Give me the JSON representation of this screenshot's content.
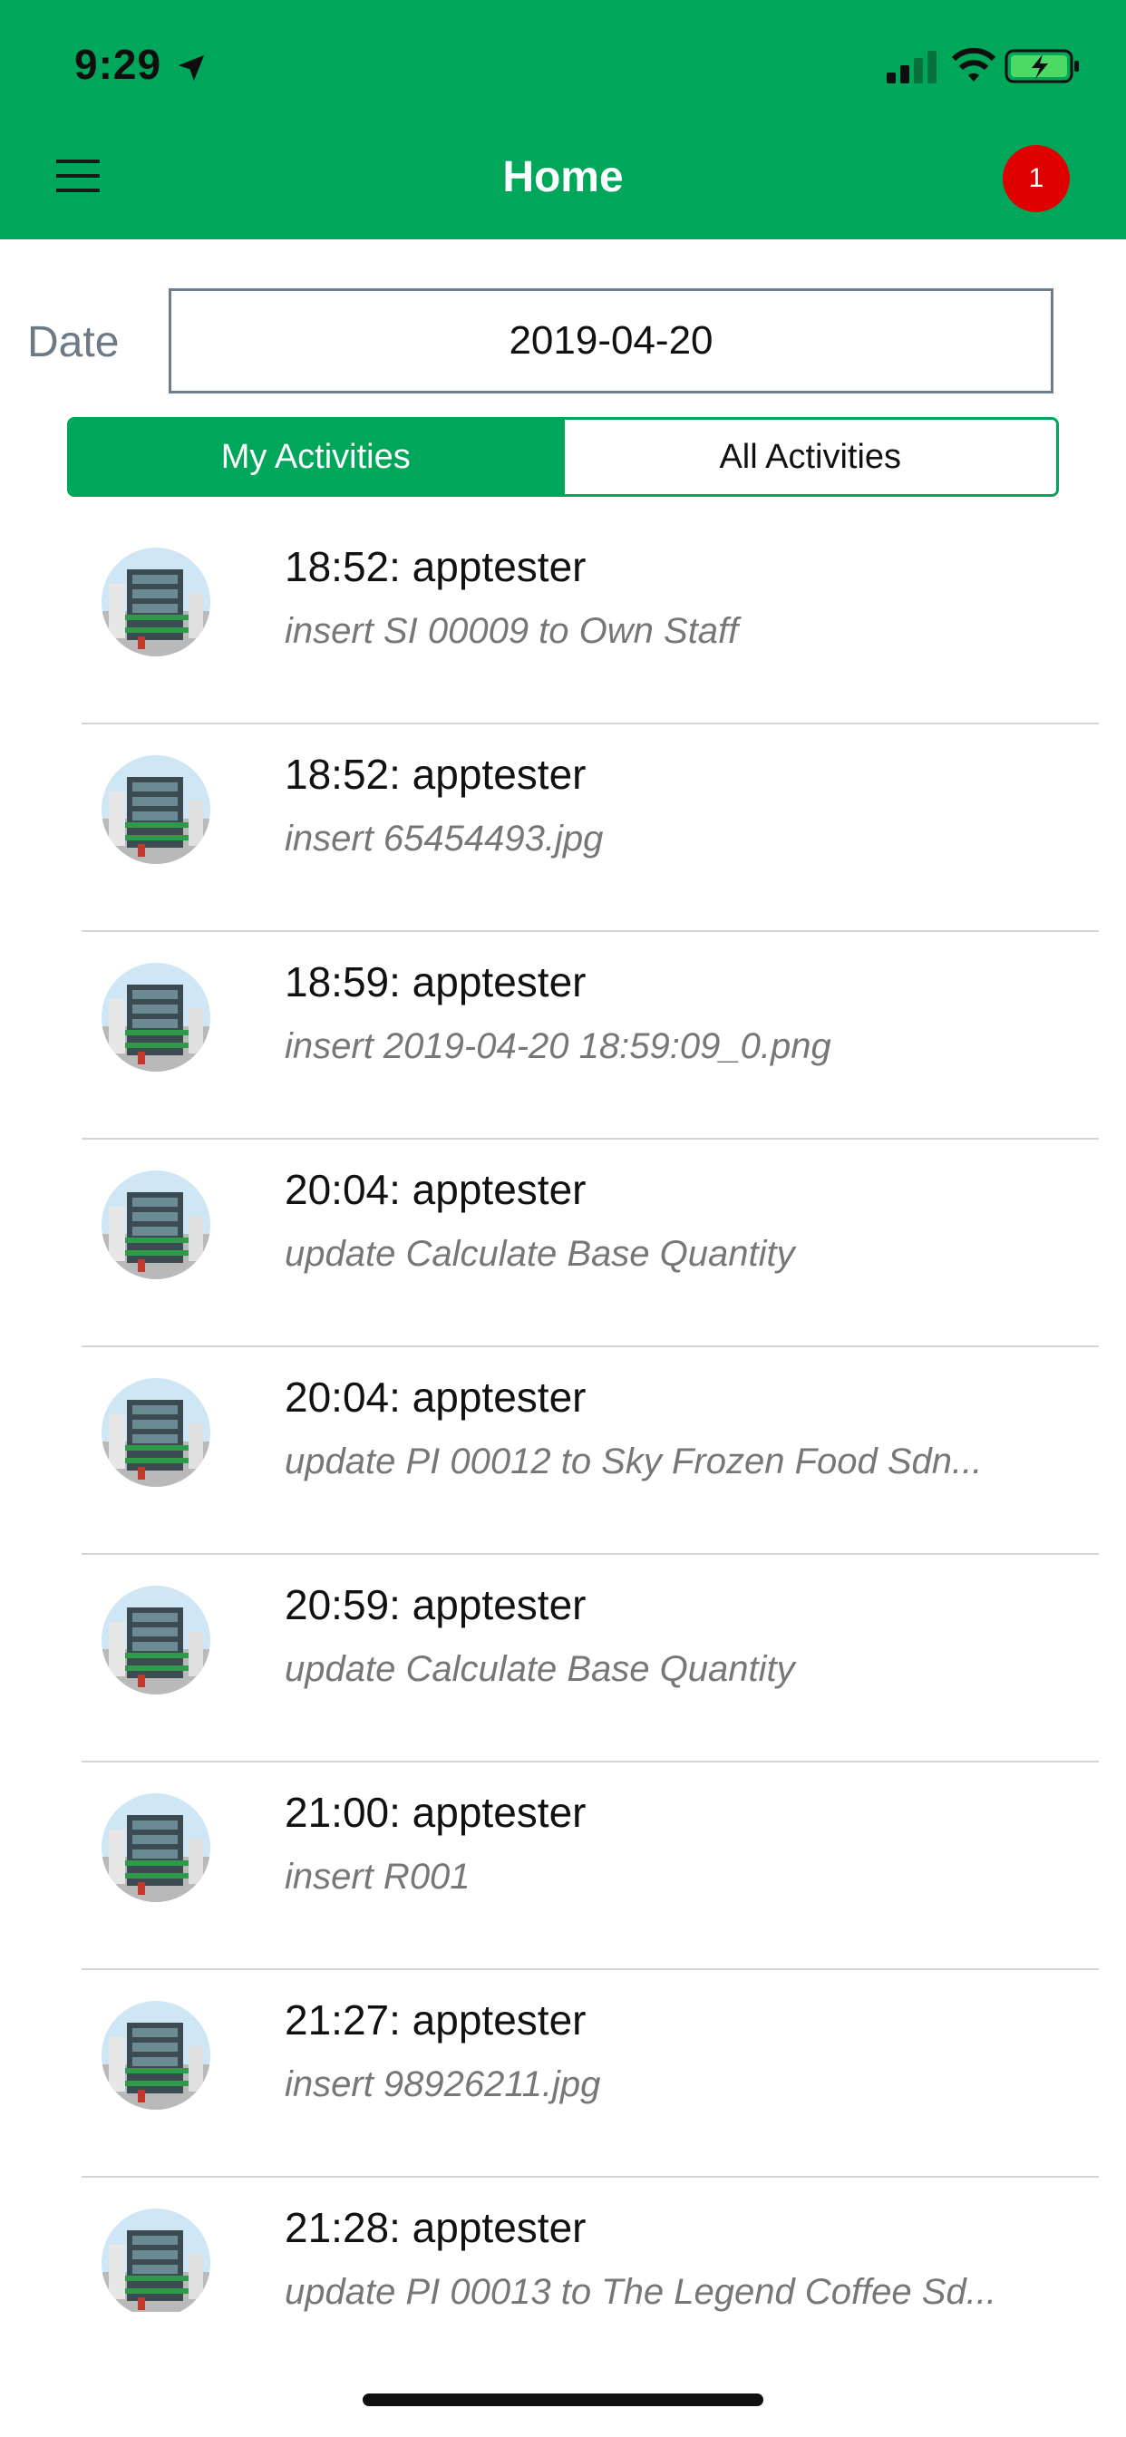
{
  "status_bar": {
    "time": "9:29"
  },
  "header": {
    "title": "Home",
    "notification_count": "1"
  },
  "date_filter": {
    "label": "Date",
    "value": "2019-04-20"
  },
  "tabs": [
    {
      "label": "My Activities",
      "active": true
    },
    {
      "label": "All Activities",
      "active": false
    }
  ],
  "activities": [
    {
      "title": "18:52: apptester",
      "desc": "insert SI 00009 to Own Staff"
    },
    {
      "title": "18:52: apptester",
      "desc": "insert 65454493.jpg"
    },
    {
      "title": "18:59: apptester",
      "desc": "insert 2019-04-20 18:59:09_0.png"
    },
    {
      "title": "20:04: apptester",
      "desc": "update Calculate Base Quantity"
    },
    {
      "title": "20:04: apptester",
      "desc": "update PI 00012 to Sky Frozen Food Sdn..."
    },
    {
      "title": "20:59: apptester",
      "desc": "update Calculate Base Quantity"
    },
    {
      "title": "21:00: apptester",
      "desc": "insert R001"
    },
    {
      "title": "21:27: apptester",
      "desc": "insert 98926211.jpg"
    },
    {
      "title": "21:28: apptester",
      "desc": "update PI 00013 to The Legend Coffee Sd..."
    }
  ],
  "colors": {
    "primary": "#00a65a",
    "badge": "#e00000"
  },
  "icons": {
    "menu": "hamburger-icon",
    "location": "location-arrow-icon",
    "signal": "cellular-signal-icon",
    "wifi": "wifi-icon",
    "battery": "battery-charging-icon"
  }
}
